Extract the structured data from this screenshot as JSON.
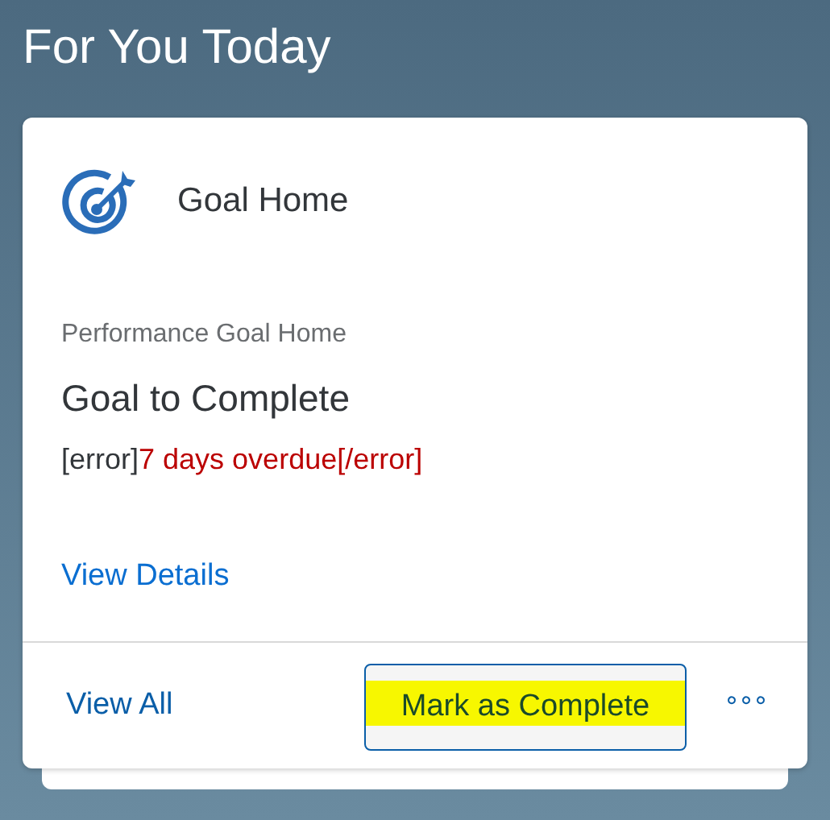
{
  "page_title": "For You Today",
  "card": {
    "title": "Goal Home",
    "subtitle": "Performance Goal Home",
    "heading": "Goal to Complete",
    "status": {
      "prefix": "[error]",
      "text": "7 days overdue[/error]"
    },
    "details_link": "View Details",
    "footer": {
      "link": "View All",
      "button": {
        "label": "Mark as Complete",
        "highlighted": true
      },
      "more": "°°°"
    }
  }
}
